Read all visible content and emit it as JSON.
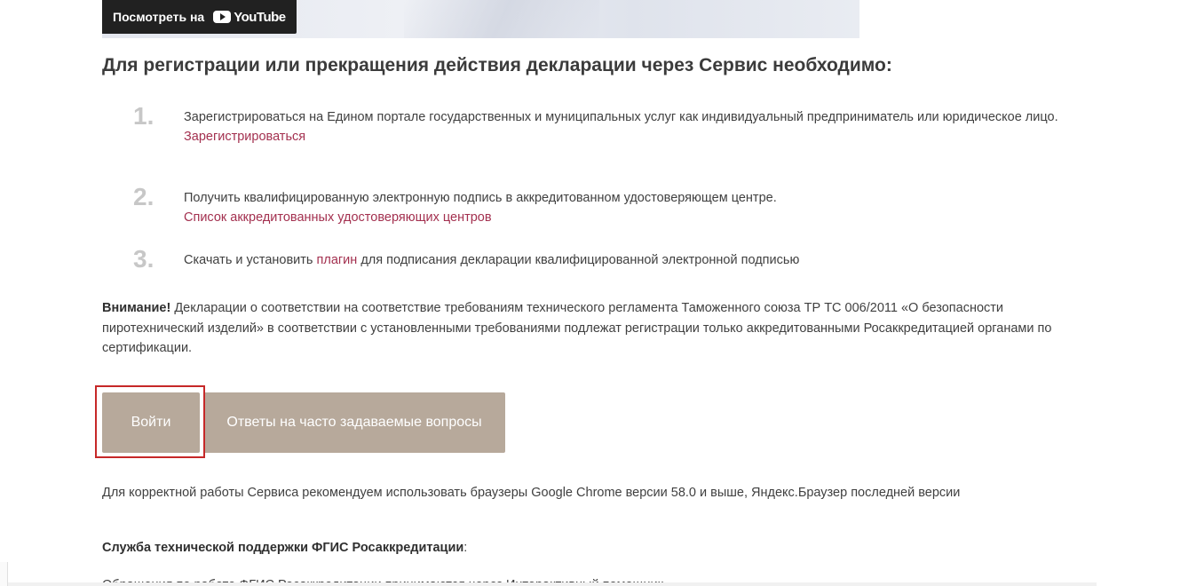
{
  "video": {
    "watch_on": "Посмотреть на",
    "youtube": "YouTube"
  },
  "page": {
    "title": "Для регистрации или прекращения действия декларации через Сервис необходимо:"
  },
  "steps": [
    {
      "number": "1.",
      "text": "Зарегистрироваться на Едином портале государственных и муниципальных услуг как индивидуальный предприниматель или юридическое лицо.",
      "link": "Зарегистрироваться"
    },
    {
      "number": "2.",
      "text": "Получить квалифицированную электронную подпись в аккредитованном удостоверяющем центре.",
      "link": "Список аккредитованных удостоверяющих центров"
    },
    {
      "number": "3.",
      "text_before": "Скачать и установить ",
      "link": "плагин",
      "text_after": " для подписания декларации квалифицированной электронной подписью"
    }
  ],
  "notice": {
    "label": "Внимание!",
    "text": " Декларации о соответствии на соответствие требованиям технического регламента Таможенного союза ТР ТС 006/2011 «О безопасности пиротехнический изделий» в соответствии с установленными требованиями подлежат регистрации только аккредитованными Росаккредитацией органами по сертификации."
  },
  "buttons": {
    "login": "Войти",
    "faq": "Ответы на часто задаваемые вопросы"
  },
  "browser_note": "Для корректной работы Сервиса рекомендуем использовать браузеры Google Chrome версии 58.0 и выше, Яндекс.Браузер последней версии",
  "support": {
    "title": "Служба технической поддержки ФГИС Росаккредитации",
    "colon": ":",
    "partial_text": "Обращения по работе ФГИС Росаккредитации принимаются через Интерактивный помощник"
  },
  "colors": {
    "button_bg": "#b7a99b",
    "link": "#a3304f",
    "highlight": "#c62828"
  }
}
